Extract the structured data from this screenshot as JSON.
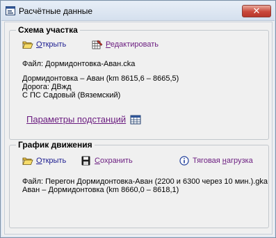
{
  "window": {
    "title": "Расчётные данные",
    "close_symbol": "✕"
  },
  "scheme": {
    "title": "Схема участка",
    "open_label": "Открыть",
    "open_hotkey": "О",
    "open_rest": "ткрыть",
    "edit_label": "Редактировать",
    "edit_hotkey": "Р",
    "edit_rest": "едактировать",
    "file_line": "Файл: Дормидонтовка-Аван.cka",
    "route_line": "Дормидонтовка – Аван  (km  8615,6 – 8665,5)",
    "road_line": "Дорога: ДВжд",
    "substation_line": "С ПС Садовый (Вяземский)",
    "substation_params_label": "Параметры подстанций"
  },
  "schedule": {
    "title": "График движения",
    "open_label": "Открыть",
    "open_hotkey": "О",
    "open_rest": "ткрыть",
    "save_label": "Сохранить",
    "save_hotkey": "С",
    "save_rest": "охранить",
    "traction_label": "Тяговая нагрузка",
    "traction_pre": "Тяговая ",
    "traction_hotkey": "н",
    "traction_rest": "агрузка",
    "file_line": "Файл: Перегон Дормидонтовка-Аван (2200 и 6300 через 10 мин.).gka",
    "route_line": "Аван – Дормидонтовка  (km  8660,0 – 8618,1)"
  }
}
